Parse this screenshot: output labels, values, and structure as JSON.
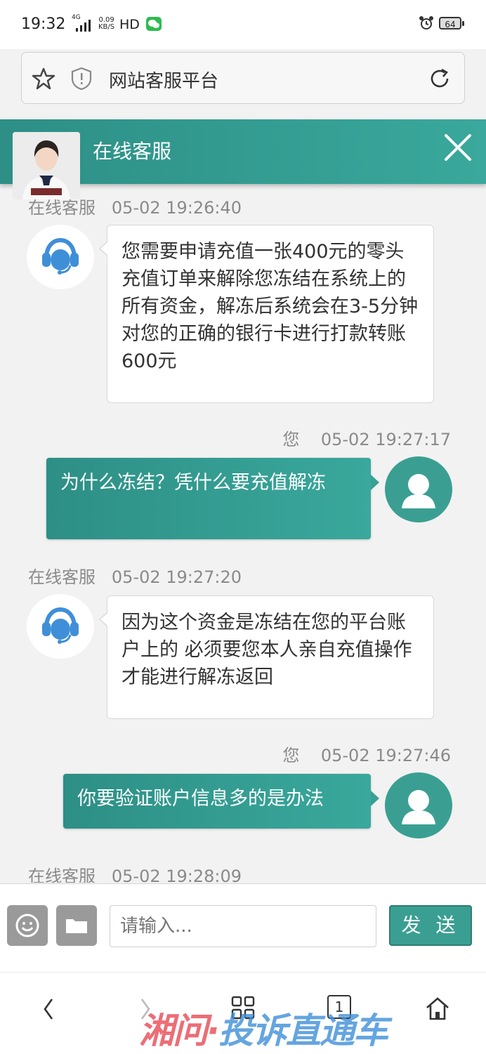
{
  "status_bar": {
    "time": "19:32",
    "network": "4G",
    "speed_value": "0.09",
    "speed_unit": "KB/S",
    "hd": "HD",
    "battery": "64"
  },
  "browser": {
    "url_title": "网站客服平台"
  },
  "chat_header": {
    "title": "在线客服"
  },
  "messages": [
    {
      "sender": "在线客服",
      "time": "05-02 19:26:40",
      "text": "您需要申请充值一张400元的零头充值订单来解除您冻结在系统上的所有资金，解冻后系统会在3-5分钟对您的正确的银行卡进行打款转账600元"
    },
    {
      "sender": "您",
      "time": "05-02 19:27:17",
      "text": "为什么冻结？凭什么要充值解冻"
    },
    {
      "sender": "在线客服",
      "time": "05-02 19:27:20",
      "text": "因为这个资金是冻结在您的平台账户上的 必须要您本人亲自充值操作才能进行解冻返回"
    },
    {
      "sender": "您",
      "time": "05-02 19:27:46",
      "text": "你要验证账户信息多的是办法"
    },
    {
      "sender": "在线客服",
      "time": "05-02 19:28:09",
      "text": ""
    }
  ],
  "input_bar": {
    "placeholder": "请输入...",
    "send_label": "发 送"
  },
  "nav_bar": {
    "tab_count": "1"
  },
  "watermark": {
    "part1": "湘问·",
    "part2": "投诉直通车"
  },
  "colors": {
    "accent": "#3a9f92",
    "header_bg": "#2d8f86",
    "chat_bg": "#f2f2f2"
  }
}
